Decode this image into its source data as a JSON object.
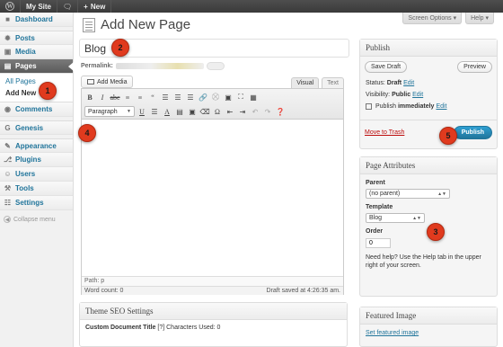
{
  "adminbar": {
    "site": "My Site",
    "new": "New"
  },
  "screen_tabs": {
    "options": "Screen Options",
    "help": "Help"
  },
  "sidebar": {
    "items": [
      {
        "label": "Dashboard"
      },
      {
        "label": "Posts"
      },
      {
        "label": "Media"
      },
      {
        "label": "Pages"
      },
      {
        "label": "Comments"
      },
      {
        "label": "Genesis"
      },
      {
        "label": "Appearance"
      },
      {
        "label": "Plugins"
      },
      {
        "label": "Users"
      },
      {
        "label": "Tools"
      },
      {
        "label": "Settings"
      }
    ],
    "submenu": [
      "All Pages",
      "Add New"
    ],
    "collapse": "Collapse menu"
  },
  "page": {
    "title": "Add New Page",
    "title_value": "Blog",
    "permalink_label": "Permalink:"
  },
  "editor": {
    "add_media": "Add Media",
    "tab_visual": "Visual",
    "tab_text": "Text",
    "format": "Paragraph",
    "path": "Path: p",
    "word_count": "Word count: 0",
    "draft_saved": "Draft saved at 4:26:35 am."
  },
  "seo": {
    "title": "Theme SEO Settings",
    "doc_title_label": "Custom Document Title",
    "doc_title_hint": "[?] Characters Used: 0"
  },
  "publish": {
    "title": "Publish",
    "save_draft": "Save Draft",
    "preview": "Preview",
    "status_label": "Status:",
    "status_value": "Draft",
    "visibility_label": "Visibility:",
    "visibility_value": "Public",
    "publish_label": "Publish",
    "publish_value": "immediately",
    "edit": "Edit",
    "trash": "Move to Trash",
    "publish_btn": "Publish"
  },
  "attributes": {
    "title": "Page Attributes",
    "parent_label": "Parent",
    "parent_value": "(no parent)",
    "template_label": "Template",
    "template_value": "Blog",
    "order_label": "Order",
    "order_value": "0",
    "help": "Need help? Use the Help tab in the upper right of your screen."
  },
  "featured": {
    "title": "Featured Image",
    "link": "Set featured image"
  },
  "markers": [
    "1",
    "2",
    "3",
    "4",
    "5"
  ]
}
